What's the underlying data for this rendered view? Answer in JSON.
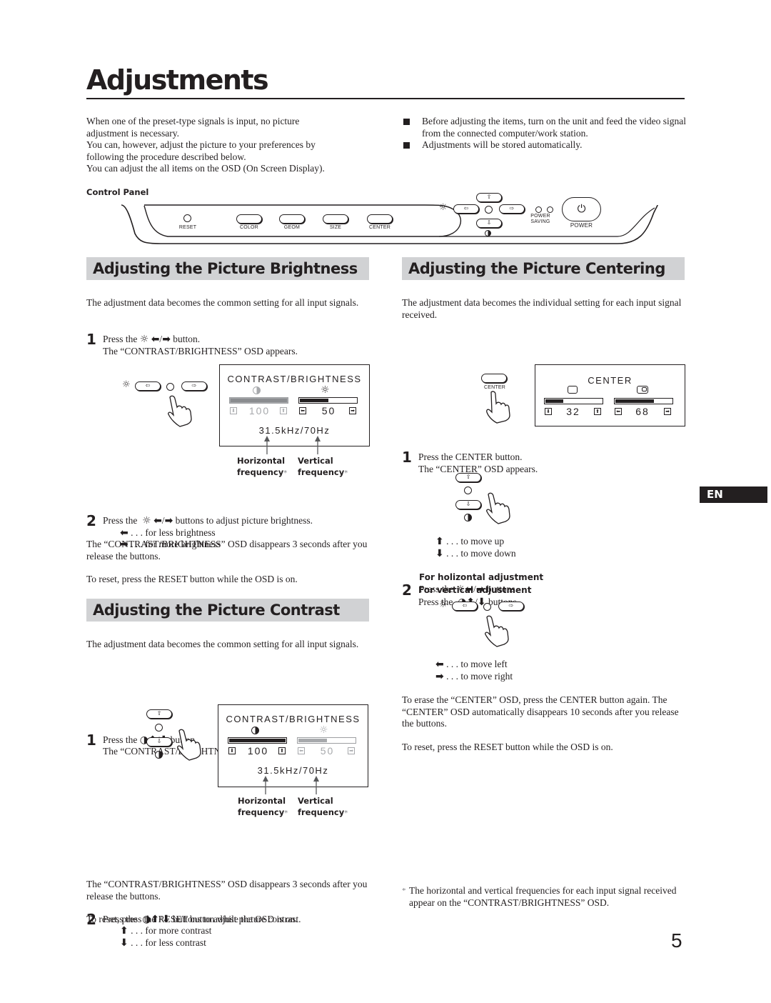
{
  "page": {
    "title": "Adjustments",
    "page_number": "5",
    "language_tab": "EN"
  },
  "intro": {
    "lines": [
      "When one of the preset-type signals is input, no picture",
      "adjustment is necessary.",
      "You can, however, adjust the picture to your preferences by",
      "following the procedure described below.",
      "You can adjust the all items on the OSD (On Screen Display)."
    ],
    "bullets": [
      "Before adjusting the items, turn on the unit and feed the video signal from the connected computer/work station.",
      "Adjustments will be stored automatically."
    ]
  },
  "control_panel": {
    "label": "Control Panel",
    "buttons": [
      "RESET",
      "COLOR",
      "GEOM",
      "SIZE",
      "CENTER"
    ],
    "power_saving_label_1": "POWER",
    "power_saving_label_2": "SAVING",
    "power_label": "POWER",
    "icons": {
      "brightness": "sun-icon",
      "contrast": "half-circle-icon",
      "power": "power-icon",
      "up": "arrow-up-icon",
      "down": "arrow-down-icon",
      "left": "arrow-left-icon",
      "right": "arrow-right-icon"
    }
  },
  "brightness": {
    "heading": "Adjusting the Picture Brightness",
    "intro": "The adjustment data becomes the common setting for all input signals.",
    "step1_num": "1",
    "step1_line1_pre": "Press the",
    "step1_line1_post": "button.",
    "step1_line2": "The “CONTRAST/BRIGHTNESS” OSD appears.",
    "osd": {
      "title": "CONTRAST/BRIGHTNESS",
      "contrast_value": "100",
      "contrast_level": 1.0,
      "brightness_value": "50",
      "brightness_level": 0.5,
      "frequency": "31.5kHz/70Hz",
      "active": "brightness"
    },
    "freq_labels": {
      "horizontal_1": "Horizontal",
      "horizontal_2": "frequency",
      "vertical_1": "Vertical",
      "vertical_2": "frequency",
      "star": "*"
    },
    "step2_num": "2",
    "step2_pre": "Press the",
    "step2_post": "buttons to adjust picture brightness.",
    "less": ". . . for less brightness",
    "more": ". . . for more brightness",
    "disappear": "The “CONTRAST/BRIGHTNESS”  OSD disappears 3 seconds after you release the buttons.",
    "reset": "To reset, press the RESET button while the OSD is on."
  },
  "contrast": {
    "heading": "Adjusting the Picture Contrast",
    "intro": "The adjustment data becomes the common setting for all input signals.",
    "step1_num": "1",
    "step1_line1_pre": "Press the",
    "step1_line1_post": "button.",
    "step1_line2": "The “CONTRAST/BRIGHTNESS” OSD appears.",
    "osd": {
      "title": "CONTRAST/BRIGHTNESS",
      "contrast_value": "100",
      "contrast_level": 1.0,
      "brightness_value": "50",
      "brightness_level": 0.5,
      "frequency": "31.5kHz/70Hz",
      "active": "contrast"
    },
    "freq_labels": {
      "horizontal_1": "Horizontal",
      "horizontal_2": "frequency",
      "vertical_1": "Vertical",
      "vertical_2": "frequency",
      "star": "*"
    },
    "step2_num": "2",
    "step2_pre": "Press the",
    "step2_post": "buttons to adjust picture contrast.",
    "more": ". . . for more contrast",
    "less": ". . . for less contrast",
    "disappear": "The “CONTRAST/BRIGHTNESS” OSD disappears 3 seconds after you release the buttons.",
    "reset": "To reset, press the RESET button while the OSD is on."
  },
  "centering": {
    "heading": "Adjusting the Picture Centering",
    "intro": "The adjustment data becomes the individual setting for each input signal received.",
    "step1_num": "1",
    "step1_line1": "Press the CENTER button.",
    "step1_line2": "The “CENTER” OSD appears.",
    "center_button_label": "CENTER",
    "osd": {
      "title": "CENTER",
      "vertical_value": "32",
      "vertical_level": 0.32,
      "horizontal_value": "68",
      "horizontal_level": 0.68
    },
    "step2_num": "2",
    "vertical_heading": "For vertical adjustment",
    "vertical_pre": "Press the",
    "vertical_post": "buttons.",
    "move_up": ". . . to move up",
    "move_down": ". . . to move down",
    "horizontal_heading": "For holizontal adjustment",
    "horizontal_pre": "Press the",
    "horizontal_post": "buttons.",
    "move_left": ". . . to move left",
    "move_right": ". . . to move right",
    "erase": "To erase the “CENTER” OSD, press the CENTER button again. The “CENTER” OSD automatically disappears 10 seconds after you release the buttons.",
    "reset": "To reset, press the RESET button while the OSD is on."
  },
  "footnote": {
    "star": "*",
    "text": "The horizontal and vertical frequencies for each input signal received appear on the “CONTRAST/BRIGHTNESS” OSD."
  }
}
